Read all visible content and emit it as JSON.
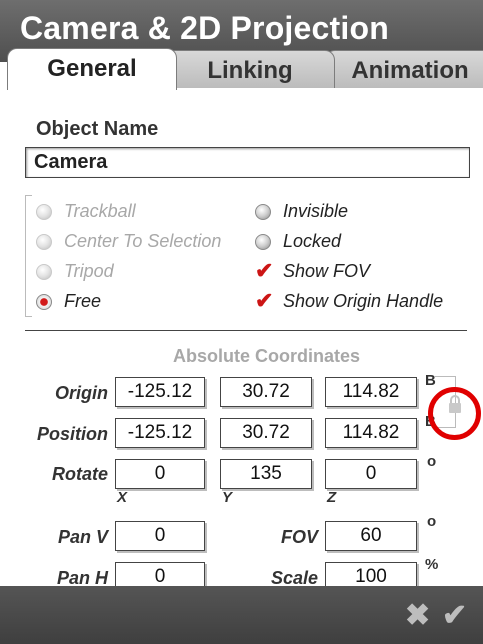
{
  "window": {
    "title": "Camera & 2D Projection"
  },
  "tabs": [
    {
      "label": "General",
      "active": true
    },
    {
      "label": "Linking",
      "active": false
    },
    {
      "label": "Animation",
      "active": false
    }
  ],
  "object": {
    "label": "Object Name",
    "value": "Camera"
  },
  "modes": {
    "trackball": "Trackball",
    "center_to_selection": "Center To Selection",
    "tripod": "Tripod",
    "free": "Free",
    "selected": "Free"
  },
  "flags": {
    "invisible": {
      "label": "Invisible",
      "checked": false
    },
    "locked": {
      "label": "Locked",
      "checked": false
    },
    "show_fov": {
      "label": "Show FOV",
      "checked": true
    },
    "show_origin_handle": {
      "label": "Show Origin Handle",
      "checked": true
    }
  },
  "coords": {
    "section_title": "Absolute Coordinates",
    "origin": {
      "label": "Origin",
      "x": "-125.12",
      "y": "30.72",
      "z": "114.82",
      "unit": "B"
    },
    "position": {
      "label": "Position",
      "x": "-125.12",
      "y": "30.72",
      "z": "114.82",
      "unit": "B"
    },
    "rotate": {
      "label": "Rotate",
      "x": "0",
      "y": "135",
      "z": "0",
      "unit": "o"
    },
    "axes": {
      "x": "X",
      "y": "Y",
      "z": "Z"
    }
  },
  "pan": {
    "pan_v": {
      "label": "Pan V",
      "value": "0"
    },
    "pan_h": {
      "label": "Pan H",
      "value": "0"
    }
  },
  "lens": {
    "fov": {
      "label": "FOV",
      "value": "60",
      "unit": "o"
    },
    "scale": {
      "label": "Scale",
      "value": "100",
      "unit": "%"
    }
  },
  "footer": {
    "cancel_icon": "✖",
    "ok_icon": "✔"
  },
  "colors": {
    "accent": "#cc1515",
    "titlebar": "#5a5a5a",
    "highlight_circle": "#e00000"
  }
}
